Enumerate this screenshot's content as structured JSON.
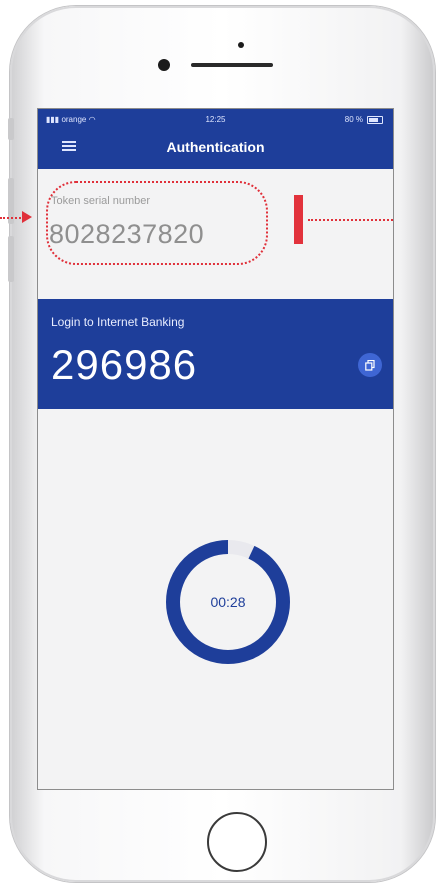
{
  "status_bar": {
    "carrier": "orange",
    "time": "12:25",
    "battery": "80 %"
  },
  "header": {
    "title": "Authentication"
  },
  "token": {
    "label": "Token serial number",
    "serial": "8028237820"
  },
  "login": {
    "label": "Login to Internet Banking",
    "code": "296986"
  },
  "timer": {
    "remaining": "00:28",
    "progress": 0.93
  },
  "colors": {
    "primary": "#1e3e9a",
    "accent": "#3f66d4",
    "highlight": "#e0303a",
    "background": "#f3f3f4"
  },
  "icons": {
    "menu": "hamburger-icon",
    "copy": "copy-icon",
    "wifi": "wifi-icon",
    "signal": "signal-icon",
    "battery": "battery-icon"
  }
}
